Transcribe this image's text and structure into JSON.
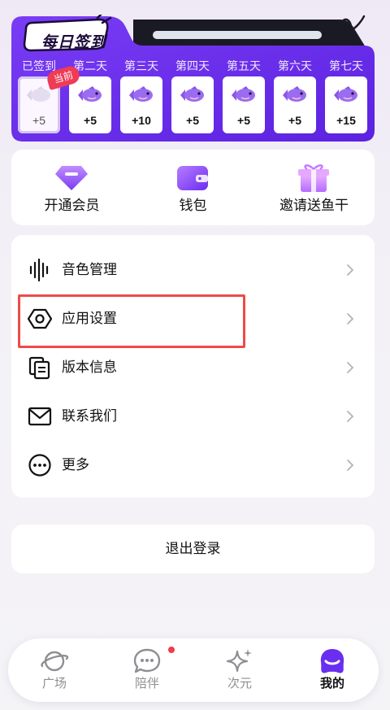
{
  "checkin": {
    "title": "每日签到",
    "current_badge": "当前",
    "days": [
      {
        "label": "已签到",
        "reward": "+5"
      },
      {
        "label": "第二天",
        "reward": "+5"
      },
      {
        "label": "第三天",
        "reward": "+10"
      },
      {
        "label": "第四天",
        "reward": "+5"
      },
      {
        "label": "第五天",
        "reward": "+5"
      },
      {
        "label": "第六天",
        "reward": "+5"
      },
      {
        "label": "第七天",
        "reward": "+15"
      }
    ]
  },
  "quick_actions": [
    {
      "label": "开通会员",
      "icon": "vip-diamond-icon"
    },
    {
      "label": "钱包",
      "icon": "wallet-icon"
    },
    {
      "label": "邀请送鱼干",
      "icon": "gift-icon"
    }
  ],
  "menu": {
    "items": [
      {
        "label": "音色管理",
        "icon": "voice-wave-icon"
      },
      {
        "label": "应用设置",
        "icon": "settings-hexagon-icon"
      },
      {
        "label": "版本信息",
        "icon": "version-copy-icon"
      },
      {
        "label": "联系我们",
        "icon": "mail-icon"
      },
      {
        "label": "更多",
        "icon": "more-dots-icon"
      }
    ]
  },
  "logout_label": "退出登录",
  "bottom_nav": {
    "items": [
      {
        "label": "广场",
        "icon": "planet-icon"
      },
      {
        "label": "陪伴",
        "icon": "chat-bubble-icon"
      },
      {
        "label": "次元",
        "icon": "sparkle-icon"
      },
      {
        "label": "我的",
        "icon": "profile-blob-icon"
      }
    ],
    "active": "我的"
  },
  "colors": {
    "brand_purple": "#6a2ef0",
    "highlight_red": "#ee4a4a",
    "badge_red": "#ef3b55",
    "notification_dot": "#f23a4a"
  }
}
